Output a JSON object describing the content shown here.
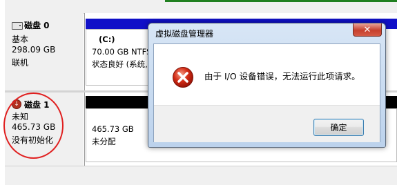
{
  "disks": [
    {
      "title": "磁盘 0",
      "type": "基本",
      "size": "298.09 GB",
      "status": "联机"
    },
    {
      "title": "磁盘 1",
      "type": "未知",
      "size": "465.73 GB",
      "status": "没有初始化"
    }
  ],
  "volumes": {
    "c_name": "(C:)",
    "c_size": "70.00 GB NTFS",
    "c_status": "状态良好 (系统,",
    "disk1_size": "465.73 GB",
    "disk1_status": "未分配"
  },
  "dialog": {
    "title": "虚拟磁盘管理器",
    "close_label": "✕",
    "message": "由于 I/O 设备错误，无法运行此项请求。",
    "ok_label": "确定"
  },
  "colors": {
    "primary_bar": "#1010c8",
    "unallocated_bar": "#000000",
    "annotation": "#e02020"
  }
}
